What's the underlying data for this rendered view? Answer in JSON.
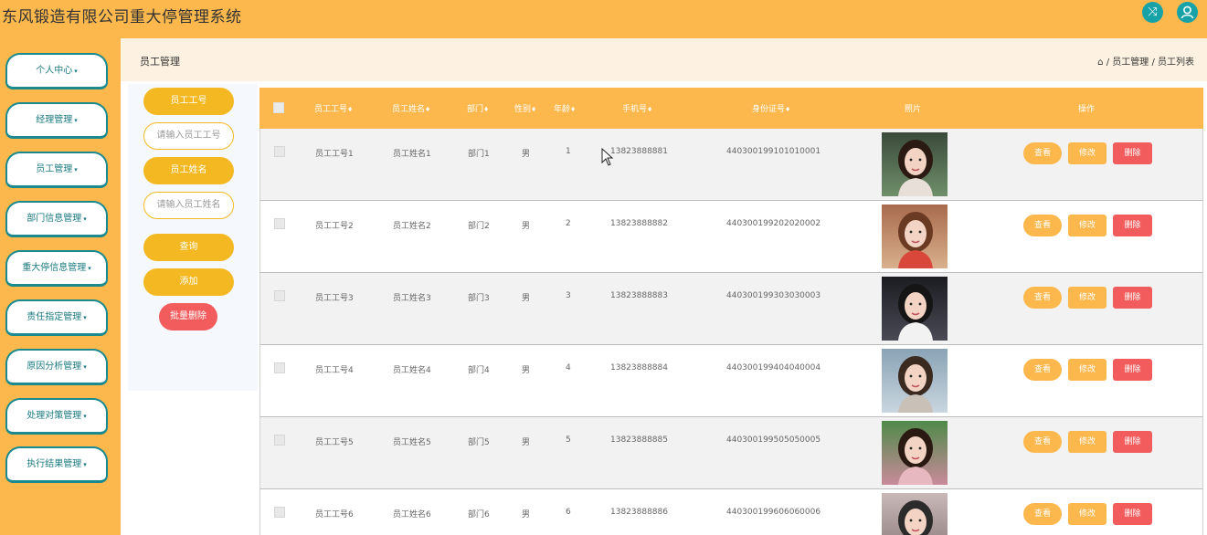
{
  "header": {
    "title": "东风锻造有限公司重大停管理系统",
    "icons": [
      "shuffle-icon",
      "user-icon"
    ]
  },
  "sidebar": {
    "items": [
      {
        "label": "个人中心"
      },
      {
        "label": "经理管理"
      },
      {
        "label": "员工管理"
      },
      {
        "label": "部门信息管理"
      },
      {
        "label": "重大停信息管理"
      },
      {
        "label": "责任指定管理"
      },
      {
        "label": "原因分析管理"
      },
      {
        "label": "处理对策管理"
      },
      {
        "label": "执行结果管理"
      }
    ],
    "caret": "▾"
  },
  "breadcrumb": {
    "title": "员工管理",
    "home_icon": "home-icon",
    "path": "/ 员工管理 / 员工列表"
  },
  "search": {
    "id_label": "员工工号",
    "id_placeholder": "请输入员工工号",
    "name_label": "员工姓名",
    "name_placeholder": "请输入员工姓名",
    "query_button": "查询",
    "add_button": "添加",
    "batch_delete_button": "批量删除"
  },
  "table": {
    "columns": [
      "员工工号",
      "员工姓名",
      "部门",
      "性别",
      "年龄",
      "手机号",
      "身份证号",
      "照片",
      "操作"
    ],
    "sort_mark": "♦",
    "rows": [
      {
        "id": "员工工号1",
        "name": "员工姓名1",
        "dept": "部门1",
        "gender": "男",
        "age": "1",
        "phone": "13823888881",
        "idcard": "440300199101010001"
      },
      {
        "id": "员工工号2",
        "name": "员工姓名2",
        "dept": "部门2",
        "gender": "男",
        "age": "2",
        "phone": "13823888882",
        "idcard": "440300199202020002"
      },
      {
        "id": "员工工号3",
        "name": "员工姓名3",
        "dept": "部门3",
        "gender": "男",
        "age": "3",
        "phone": "13823888883",
        "idcard": "440300199303030003"
      },
      {
        "id": "员工工号4",
        "name": "员工姓名4",
        "dept": "部门4",
        "gender": "男",
        "age": "4",
        "phone": "13823888884",
        "idcard": "440300199404040004"
      },
      {
        "id": "员工工号5",
        "name": "员工姓名5",
        "dept": "部门5",
        "gender": "男",
        "age": "5",
        "phone": "13823888885",
        "idcard": "440300199505050005"
      },
      {
        "id": "员工工号6",
        "name": "员工姓名6",
        "dept": "部门6",
        "gender": "男",
        "age": "6",
        "phone": "13823888886",
        "idcard": "440300199606060006"
      }
    ],
    "actions": {
      "view": "查看",
      "edit": "修改",
      "delete": "删除"
    }
  },
  "colors": {
    "accent": "#fdb84d",
    "button_yellow": "#f4b922",
    "danger": "#f25c5c",
    "teal": "#17a2a8"
  }
}
